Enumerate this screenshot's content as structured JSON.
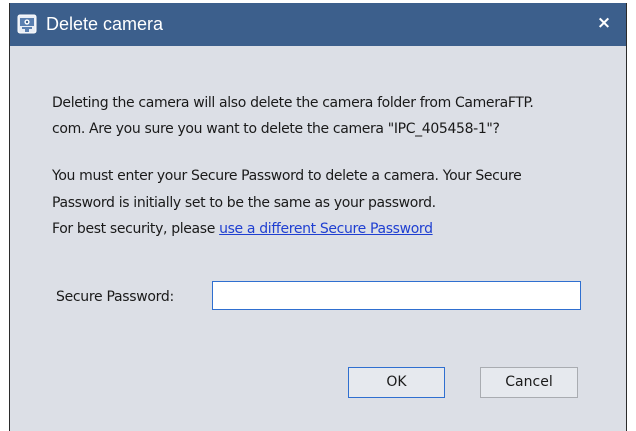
{
  "window": {
    "title": "Delete camera",
    "close_glyph": "×",
    "app_icon": "camera-app-icon"
  },
  "message": {
    "line1": "Deleting the camera will also delete the camera folder from CameraFTP.",
    "line2": "com. Are you sure you want to delete the camera \"IPC_405458-1\"?",
    "line3": "You must enter your Secure Password to delete a camera. Your Secure",
    "line4": "Password is initially set to be the same as your password.",
    "line5_prefix": "For best security, please ",
    "line5_link": "use a different Secure Password"
  },
  "form": {
    "password_label": "Secure Password:",
    "password_value": "",
    "password_placeholder": ""
  },
  "buttons": {
    "ok_label": "OK",
    "cancel_label": "Cancel"
  },
  "colors": {
    "titlebar": "#3c5f8c",
    "dialog_background": "#dcdfe6",
    "link": "#1f3fd1",
    "focus_border": "#2f6fd0"
  }
}
